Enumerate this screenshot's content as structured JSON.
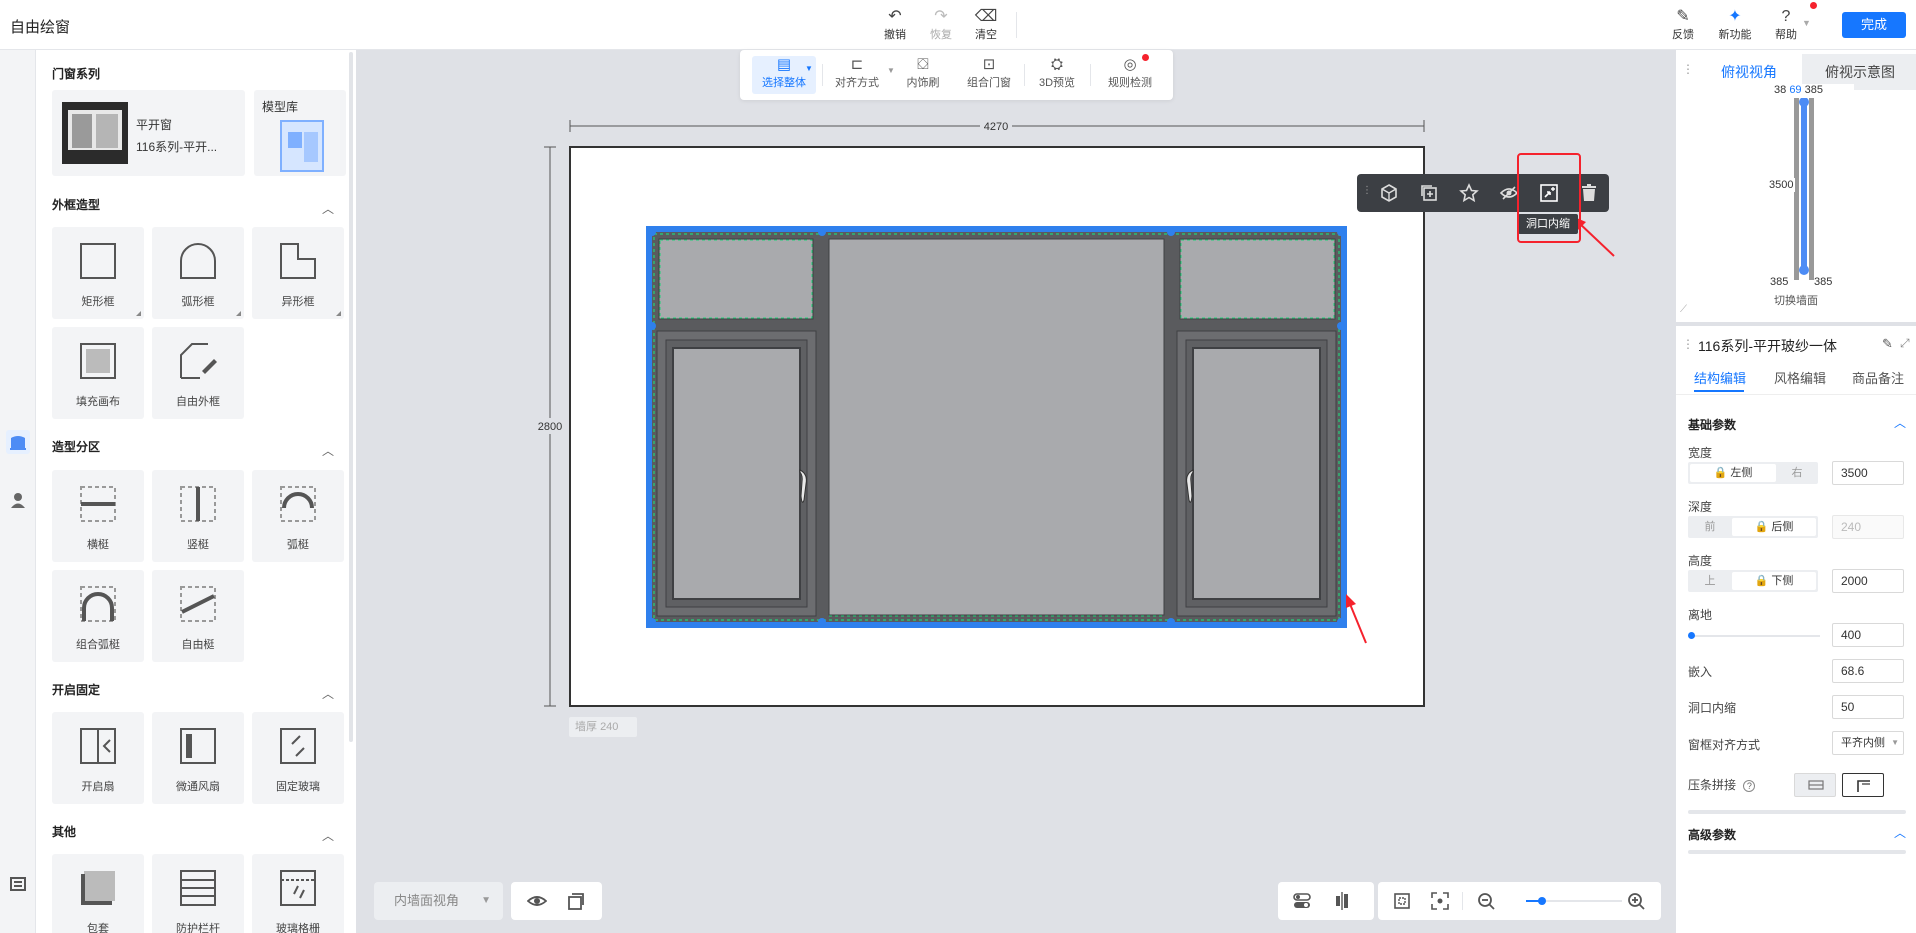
{
  "app": {
    "title": "自由绘窗"
  },
  "toolbar": {
    "undo": "撤销",
    "redo": "恢复",
    "clear": "清空",
    "feedback": "反馈",
    "new_feature": "新功能",
    "help": "帮助",
    "done": "完成"
  },
  "canvas_toolbar": {
    "select_all": "选择整体",
    "align": "对齐方式",
    "decor_brush": "内饰刷",
    "combine_door": "组合门窗",
    "preview_3d": "3D预览",
    "rule_check": "规则检测"
  },
  "left_panel": {
    "series_title": "门窗系列",
    "series_item": {
      "name": "平开窗",
      "subtitle": "116系列-平开..."
    },
    "model_lib": "模型库",
    "sections": [
      {
        "title": "外框造型",
        "items": [
          "矩形框",
          "弧形框",
          "异形框",
          "填充画布",
          "自由外框"
        ]
      },
      {
        "title": "造型分区",
        "items": [
          "横梃",
          "竖梃",
          "弧梃",
          "组合弧梃",
          "自由梃"
        ]
      },
      {
        "title": "开启固定",
        "items": [
          "开启扇",
          "微通风扇",
          "固定玻璃"
        ]
      },
      {
        "title": "其他",
        "items": [
          "包套",
          "防护栏杆",
          "玻璃格栅"
        ]
      }
    ]
  },
  "drawing": {
    "width_dim": "4270",
    "height_dim": "2800",
    "wall_thickness_label": "墙厚",
    "wall_thickness_value": "240",
    "tooltip": "洞口内缩"
  },
  "bottom": {
    "view_mode": "内墙面视角"
  },
  "mini_view": {
    "tabs": [
      "俯视视角",
      "俯视示意图"
    ],
    "dims": {
      "top_left": "38",
      "top_mid": "69",
      "top_right": "385",
      "side": "3500",
      "bottom_left": "385",
      "bottom_right": "385"
    },
    "switch_wall": "切换墙面"
  },
  "properties": {
    "title": "116系列-平开玻纱一体",
    "tabs": [
      "结构编辑",
      "风格编辑",
      "商品备注"
    ],
    "basic_group": "基础参数",
    "width": {
      "label": "宽度",
      "seg_a": "左侧",
      "seg_b": "右",
      "value": "3500"
    },
    "depth": {
      "label": "深度",
      "seg_a": "前",
      "seg_b": "后侧",
      "value": "240"
    },
    "height": {
      "label": "高度",
      "seg_a": "上",
      "seg_b": "下侧",
      "value": "2000"
    },
    "off_ground": {
      "label": "离地",
      "value": "400"
    },
    "embed": {
      "label": "嵌入",
      "value": "68.6"
    },
    "opening_inset": {
      "label": "洞口内缩",
      "value": "50"
    },
    "frame_align": {
      "label": "窗框对齐方式",
      "value": "平齐内侧"
    },
    "bead_joint": {
      "label": "压条拼接"
    },
    "advanced_group": "高级参数"
  },
  "colors": {
    "accent": "#1677ff",
    "selection": "#2f80ed",
    "frame_dark": "#5a5b5e",
    "glass": "#a9aaad",
    "annotation_red": "#f5222d"
  }
}
